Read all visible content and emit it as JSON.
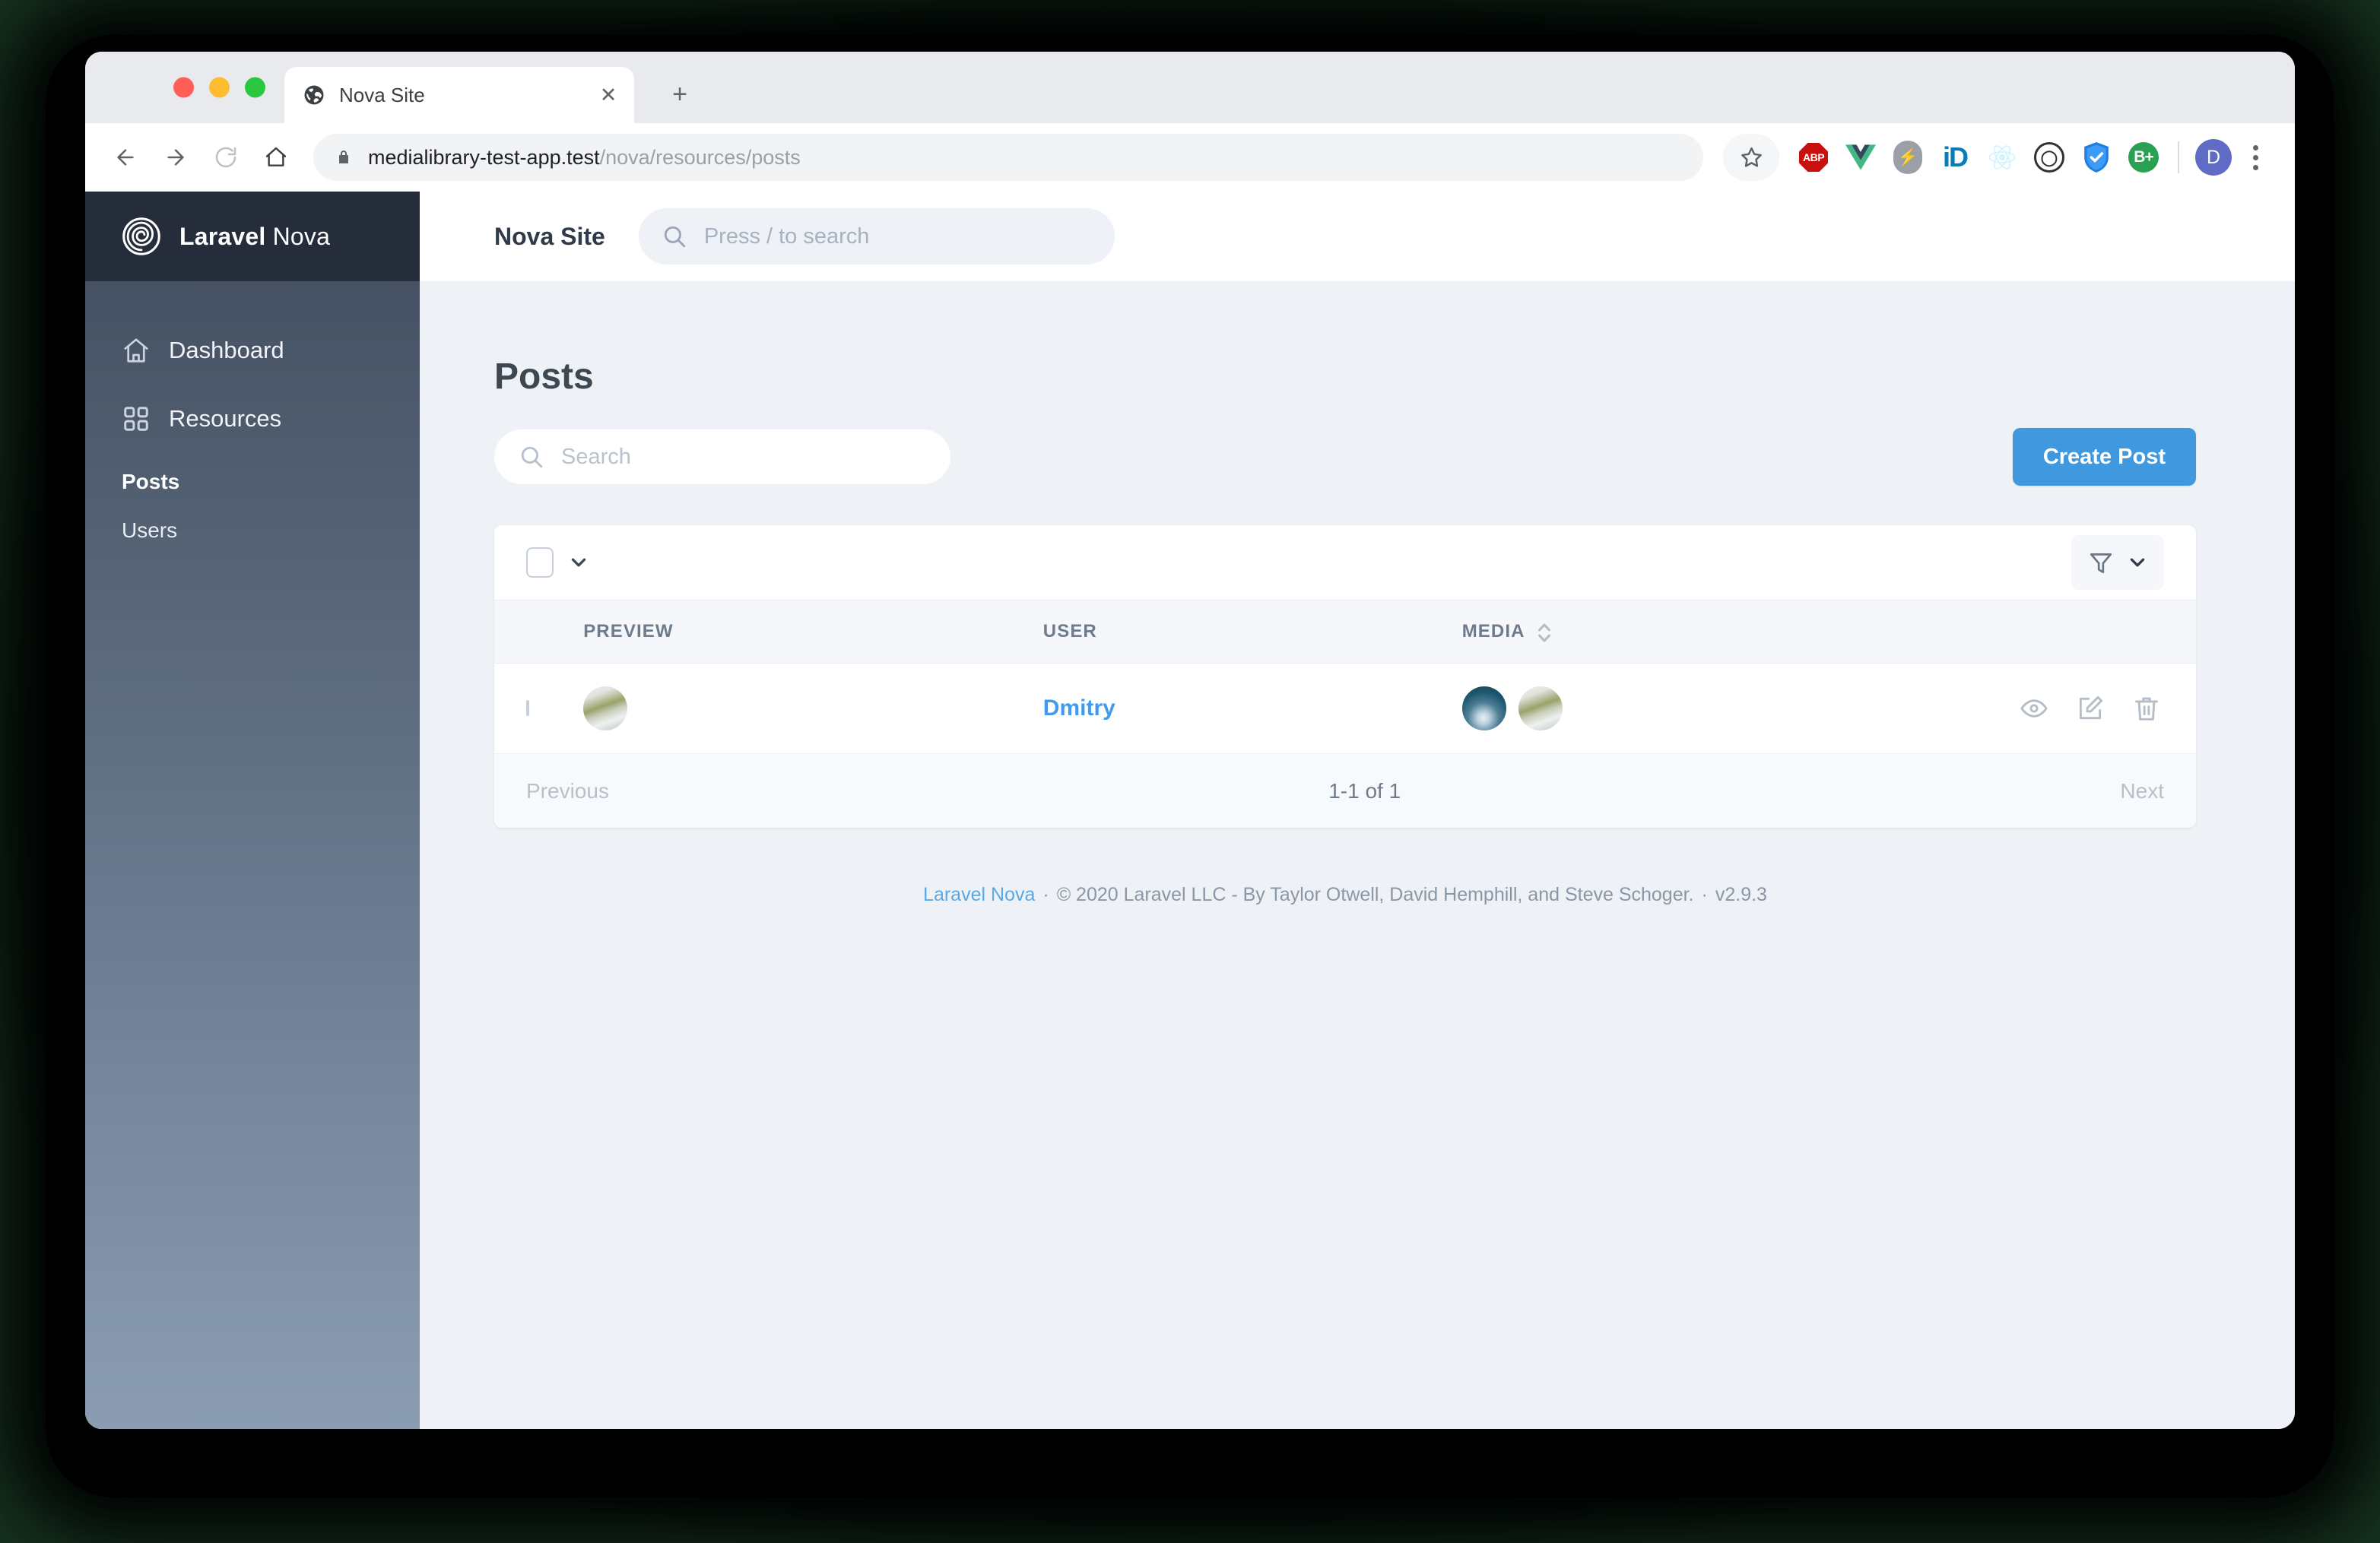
{
  "browser": {
    "tab": {
      "title": "Nova Site",
      "favicon_icon": "globe-icon",
      "close_icon": "close-icon"
    },
    "new_tab_label": "+",
    "url_domain": "medialibrary-test-app.test",
    "url_path": "/nova/resources/posts",
    "nav": {
      "back_icon": "arrow-left-icon",
      "forward_icon": "arrow-right-icon",
      "reload_icon": "reload-icon",
      "home_icon": "home-icon",
      "lock_icon": "lock-icon",
      "bookmark_icon": "star-icon"
    },
    "extensions": [
      {
        "name": "adblock-plus",
        "label": "ABP"
      },
      {
        "name": "vue-devtools",
        "label": ""
      },
      {
        "name": "bolt-extension",
        "label": "⚡"
      },
      {
        "name": "jetbrains-ide",
        "label": "iD"
      },
      {
        "name": "react-devtools",
        "label": ""
      },
      {
        "name": "1password",
        "label": ""
      },
      {
        "name": "blue-shield-security",
        "label": ""
      },
      {
        "name": "b-plus",
        "label": "B+"
      }
    ],
    "profile_initial": "D",
    "menu_icon": "three-dots-icon"
  },
  "sidebar": {
    "brand": {
      "bold": "Laravel",
      "regular": " Nova",
      "logo_icon": "nova-spiral-logo"
    },
    "items": [
      {
        "label": "Dashboard",
        "icon": "home-icon",
        "active": false
      },
      {
        "label": "Resources",
        "icon": "grid-icon",
        "active": false
      }
    ],
    "sub_items": [
      {
        "label": "Posts",
        "active": true
      },
      {
        "label": "Users",
        "active": false
      }
    ]
  },
  "topbar": {
    "site_name": "Nova Site",
    "search_placeholder": "Press / to search",
    "search_icon": "search-icon"
  },
  "main": {
    "title": "Posts",
    "search_placeholder": "Search",
    "search_value": "",
    "create_label": "Create Post",
    "select_all_icon": "checkbox-icon",
    "select_all_chevron": "chevron-down-icon",
    "filter_icon": "funnel-icon",
    "filter_chevron": "chevron-down-icon",
    "columns": [
      {
        "key": "preview",
        "label": "PREVIEW",
        "sortable": false
      },
      {
        "key": "user",
        "label": "USER",
        "sortable": false
      },
      {
        "key": "media",
        "label": "MEDIA",
        "sortable": true
      }
    ],
    "rows": [
      {
        "preview_thumb": "grass-snow-photo",
        "user": "Dmitry",
        "media_thumbs": [
          "waterfall-photo",
          "grass-snow-photo"
        ],
        "actions": [
          {
            "name": "view-action",
            "icon": "eye-icon"
          },
          {
            "name": "edit-action",
            "icon": "pencil-square-icon"
          },
          {
            "name": "delete-action",
            "icon": "trash-icon"
          }
        ]
      }
    ],
    "pagination": {
      "previous": "Previous",
      "count": "1-1 of 1",
      "next": "Next"
    }
  },
  "footer": {
    "link": "Laravel Nova",
    "separator": "·",
    "copyright": "© 2020 Laravel LLC - By Taylor Otwell, David Hemphill, and Steve Schoger.",
    "version": "v2.9.3"
  },
  "colors": {
    "accent_blue": "#4099de",
    "link_blue": "#409bf0",
    "sidebar_top": "#414d5f",
    "sidebar_bottom": "#8b9db3",
    "brand_dark": "#252d3a",
    "page_bg": "#eef1f5"
  }
}
